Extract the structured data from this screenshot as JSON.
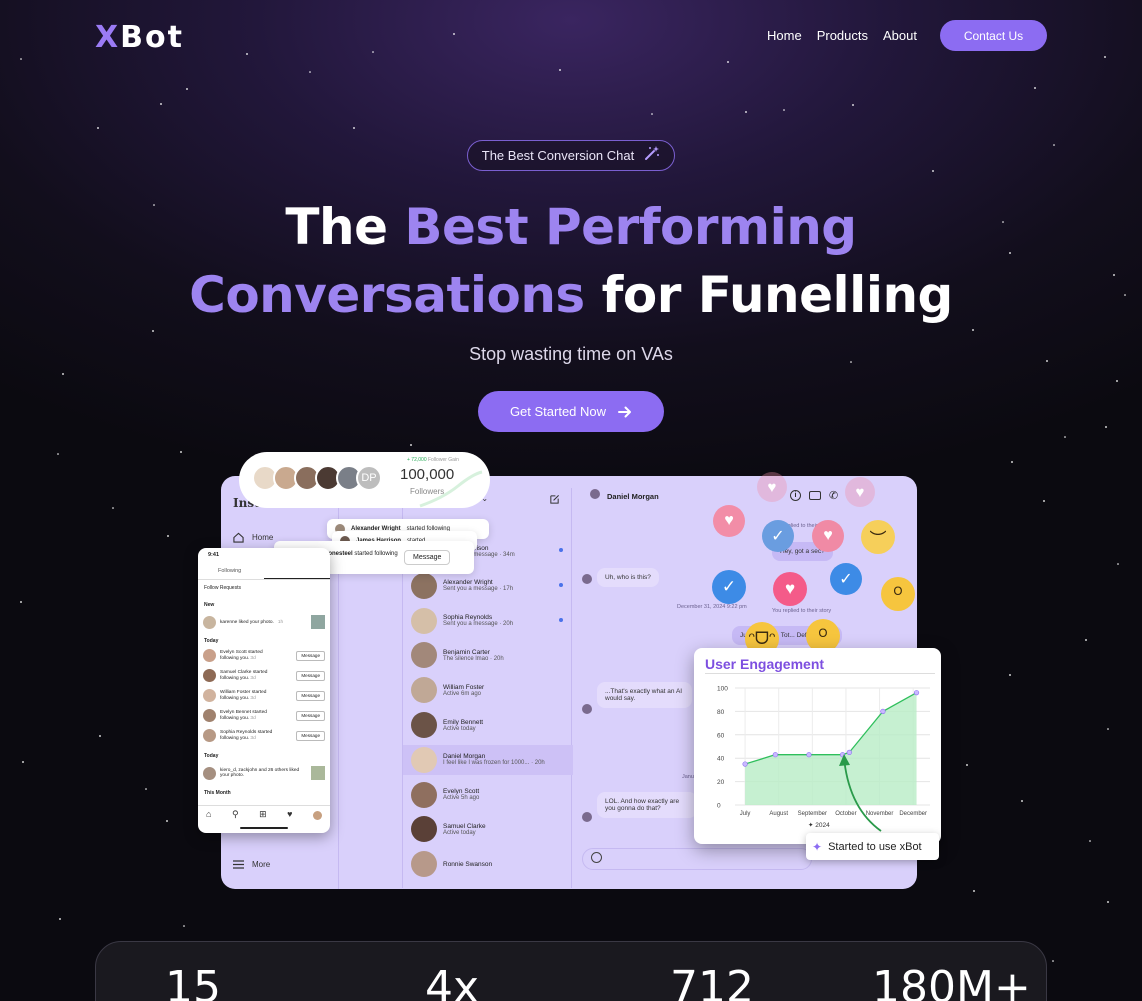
{
  "brand": {
    "logo": "XBot",
    "accent": "#8c6cf2"
  },
  "nav": {
    "home": "Home",
    "products": "Products",
    "about": "About",
    "contact": "Contact Us"
  },
  "hero": {
    "badge": "The Best Conversion Chat",
    "line1_a": "The ",
    "line1_b": "Best Performing",
    "line2_a": "Conversations",
    "line2_b": " for Funelling",
    "subtitle": "Stop wasting time on VAs",
    "cta": "Get Started Now"
  },
  "followers_card": {
    "gain_value": "+ 72,000",
    "gain_label": "Follower Gain",
    "count": "100,000",
    "label": "Followers",
    "extra_avatar": "DP"
  },
  "notifications": [
    {
      "name": "Alexander Wright",
      "text": "started following"
    },
    {
      "name": "James Harrison",
      "text": "started"
    },
    {
      "name": "Anjie Stonesteel",
      "text": "started following you.",
      "time": "3d",
      "button": "Message"
    }
  ],
  "sidebar": {
    "home": "Home",
    "more": "More",
    "brand_partial": "Insta"
  },
  "inbox": {
    "header_partial": "iff",
    "conversations": [
      {
        "name": "James Harrison",
        "status": "Sent you a message",
        "time": "· 34m",
        "unread": true
      },
      {
        "name": "Alexander Wright",
        "status": "Sent you a message",
        "time": "· 17h",
        "unread": true
      },
      {
        "name": "Sophia Reynolds",
        "status": "Sent you a message",
        "time": "· 20h",
        "unread": true
      },
      {
        "name": "Benjamin Carter",
        "status": "The silence lmao",
        "time": "· 20h",
        "unread": false
      },
      {
        "name": "William Foster",
        "status": "Active 6m ago",
        "time": "",
        "unread": false
      },
      {
        "name": "Emily Bennett",
        "status": "Active today",
        "time": "",
        "unread": false
      },
      {
        "name": "Daniel Morgan",
        "status": "I feel like I was frozen for 1000...",
        "time": "· 20h",
        "unread": false
      },
      {
        "name": "Evelyn Scott",
        "status": "Active 5h ago",
        "time": "",
        "unread": false
      },
      {
        "name": "Samuel Clarke",
        "status": "Active today",
        "time": "",
        "unread": false
      },
      {
        "name": "Ronnie Swanson",
        "status": "",
        "time": "",
        "unread": false
      }
    ]
  },
  "chat": {
    "contact": "Daniel Morgan",
    "replied_story": "You replied to their story",
    "msg1": "Hey, got a sec?",
    "msg2": "Uh, who is this?",
    "date": "December 31, 2024 9:22 pm",
    "replied_story2": "You replied to their story",
    "msg3": "Jus... person. Tot... Definitel...",
    "msg4": "...That's exactly what an AI would say.",
    "msg5": "LOL. And how exactly are you gonna do that?",
    "jan_label": "Janu..."
  },
  "phone": {
    "time": "9:41",
    "tab_following": "Following",
    "follow_requests": "Follow Requests",
    "new": "New",
    "new_item": "karenne liked your photo.",
    "new_time": "1h",
    "today": "Today",
    "today_items": [
      {
        "name": "Evelyn Scott",
        "text": "started following you.",
        "time": "3d",
        "button": "Message"
      },
      {
        "name": "Samuel Clarke",
        "text": "started following you.",
        "time": "3d",
        "button": "Message"
      },
      {
        "name": "William Foster",
        "text": "started following you.",
        "time": "3d",
        "button": "Message"
      },
      {
        "name": "Evelyn Bennet",
        "text": "started following you.",
        "time": "3d",
        "button": "Message"
      },
      {
        "name": "Sophia Reynolds",
        "text": "started following you.",
        "time": "3d",
        "button": "Message"
      }
    ],
    "today2": "Today",
    "liked_item": "kiero_d, zackjohn and 26 others liked your photo.",
    "liked_time": "3h",
    "this_month": "This Month"
  },
  "engagement": {
    "title": "User Engagement",
    "marker_label": "2024",
    "callout": "Started to use xBot"
  },
  "chart_data": {
    "type": "area",
    "categories": [
      "July",
      "August",
      "September",
      "October",
      "November",
      "December"
    ],
    "x": [
      0,
      1,
      2,
      3,
      4,
      5
    ],
    "values": [
      35,
      43,
      43,
      43,
      45,
      80,
      96
    ],
    "x_points": [
      0,
      0.9,
      1.9,
      2.9,
      3.1,
      4.1,
      5.1
    ],
    "ylim": [
      0,
      100
    ],
    "yticks": [
      "0",
      "20",
      "40",
      "60",
      "80",
      "100"
    ],
    "grid": true,
    "color": "#2fbf5c"
  },
  "stats": [
    "15",
    "4x",
    "712",
    "180M+"
  ]
}
